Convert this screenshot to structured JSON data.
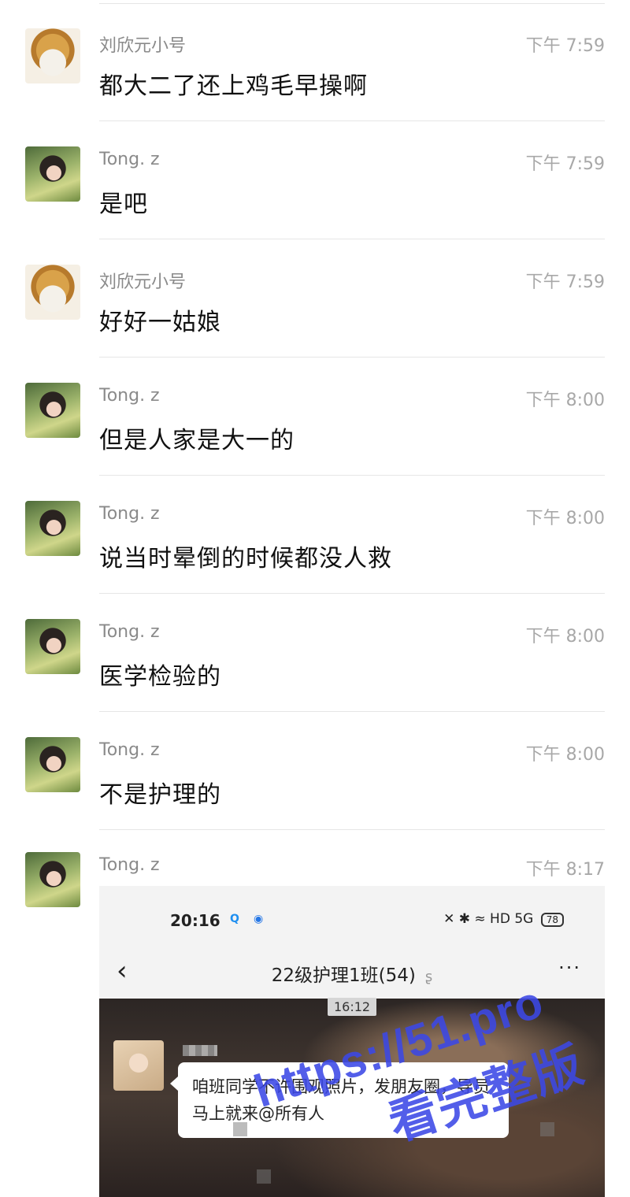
{
  "messages": [
    {
      "sender": "刘欣元小号",
      "time": "下午 7:59",
      "text": "都大二了还上鸡毛早操啊",
      "avatar_icon": "dog-avatar"
    },
    {
      "sender": "Tong. z",
      "time": "下午 7:59",
      "text": "是吧",
      "avatar_icon": "girl-avatar"
    },
    {
      "sender": "刘欣元小号",
      "time": "下午 7:59",
      "text": "好好一姑娘",
      "avatar_icon": "dog-avatar"
    },
    {
      "sender": "Tong. z",
      "time": "下午 8:00",
      "text": "但是人家是大一的",
      "avatar_icon": "girl-avatar"
    },
    {
      "sender": "Tong. z",
      "time": "下午 8:00",
      "text": "说当时晕倒的时候都没人救",
      "avatar_icon": "girl-avatar"
    },
    {
      "sender": "Tong. z",
      "time": "下午 8:00",
      "text": "医学检验的",
      "avatar_icon": "girl-avatar"
    },
    {
      "sender": "Tong. z",
      "time": "下午 8:00",
      "text": "不是护理的",
      "avatar_icon": "girl-avatar"
    }
  ],
  "image_message": {
    "sender": "Tong. z",
    "time": "下午 8:17",
    "screenshot": {
      "status_time": "20:16",
      "status_icons": "✕ ✱ ≈ HD 5G",
      "battery": "78",
      "back_glyph": "‹",
      "group_title": "22级护理1班(54)",
      "more_glyph": "···",
      "time_chip": "16:12",
      "bubble_text": "咱班同学不许围观照片，发朋友圈，导员马上就来@所有人"
    }
  },
  "watermark": {
    "line1": "https://51.pro",
    "line2": "看完整版"
  }
}
